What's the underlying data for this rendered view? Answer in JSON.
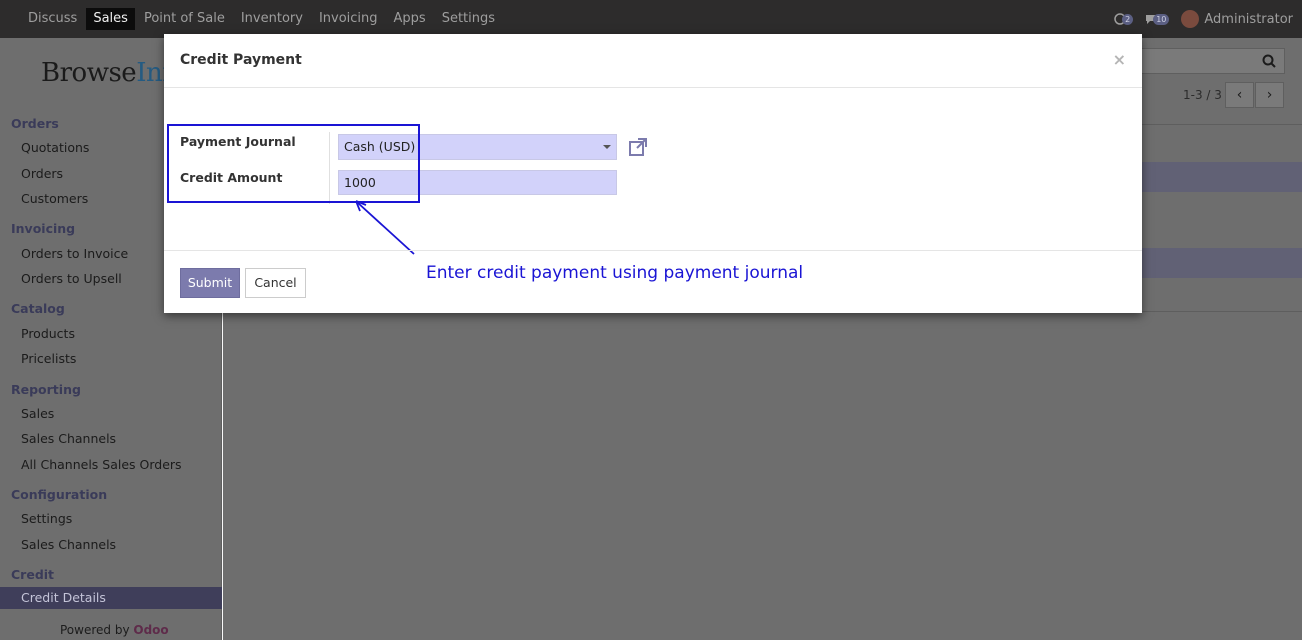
{
  "topbar": {
    "menus": [
      "Discuss",
      "Sales",
      "Point of Sale",
      "Inventory",
      "Invoicing",
      "Apps",
      "Settings"
    ],
    "active_menu": "Sales",
    "chat_count": "2",
    "message_count": "10",
    "user": "Administrator"
  },
  "logo": {
    "part1": "Browse",
    "part2": "Inf"
  },
  "sidebar": {
    "sections": [
      {
        "title": "Orders",
        "items": [
          "Quotations",
          "Orders",
          "Customers"
        ]
      },
      {
        "title": "Invoicing",
        "items": [
          "Orders to Invoice",
          "Orders to Upsell"
        ]
      },
      {
        "title": "Catalog",
        "items": [
          "Products",
          "Pricelists"
        ]
      },
      {
        "title": "Reporting",
        "items": [
          "Sales",
          "Sales Channels",
          "All Channels Sales Orders"
        ]
      },
      {
        "title": "Configuration",
        "items": [
          "Settings",
          "Sales Channels"
        ]
      },
      {
        "title": "Credit",
        "items": [
          "Credit Details"
        ]
      }
    ],
    "active_item": "Credit Details",
    "powered_by": "Powered by",
    "powered_brand": "Odoo"
  },
  "main": {
    "pager_text": "1-3 / 3"
  },
  "modal": {
    "title": "Credit Payment",
    "close": "×",
    "payment_journal_label": "Payment Journal",
    "payment_journal_value": "Cash (USD)",
    "credit_amount_label": "Credit Amount",
    "credit_amount_value": "1000",
    "submit_label": "Submit",
    "cancel_label": "Cancel",
    "annotation": "Enter credit payment using payment journal"
  },
  "colors": {
    "accent": "#7c7bad",
    "annotation": "#1a14d4",
    "field_bg": "#d2d2fa"
  }
}
